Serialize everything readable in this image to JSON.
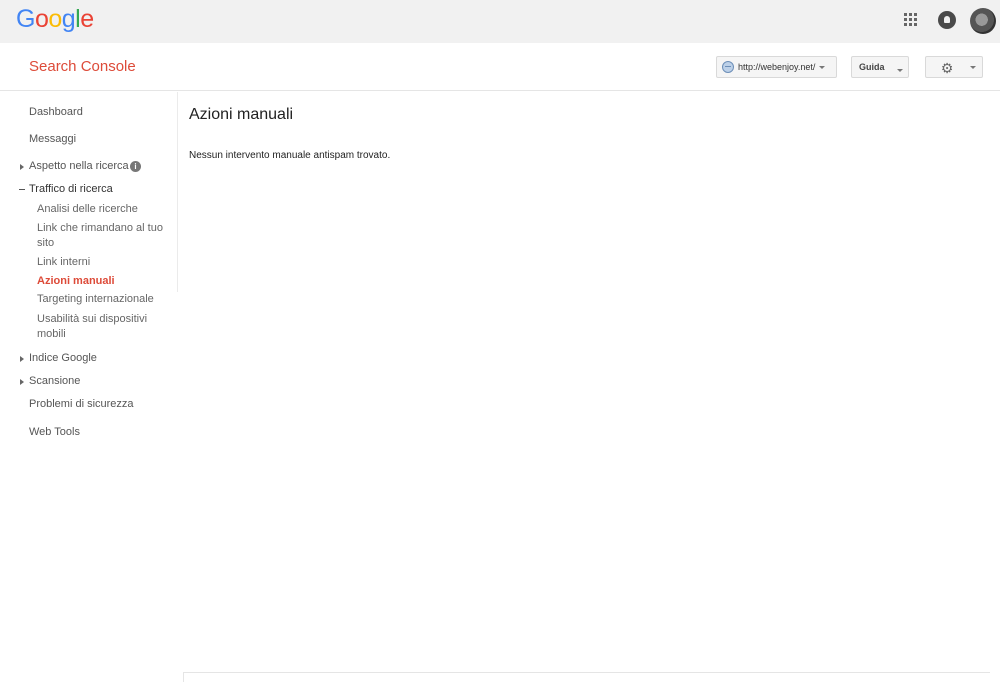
{
  "google_bar": {
    "logo": [
      "G",
      "o",
      "o",
      "g",
      "l",
      "e"
    ],
    "logo_colors": [
      "#4285f4",
      "#ea4335",
      "#fbbc05",
      "#4285f4",
      "#34a853",
      "#ea4335"
    ],
    "icons": [
      "apps-icon",
      "notifications-icon",
      "avatar"
    ]
  },
  "header": {
    "title": "Search Console",
    "title_color": "#dd4b39",
    "site_selector": "http://webenjoy.net/",
    "help_label": "Guida",
    "settings_icon": "gear-icon"
  },
  "sidebar": {
    "dashboard": "Dashboard",
    "messages": "Messaggi",
    "search_appearance": "Aspetto nella ricerca",
    "search_traffic": "Traffico di ricerca",
    "search_traffic_items": [
      "Analisi delle ricerche",
      "Link che rimandano al tuo sito",
      "Link interni",
      "Azioni manuali",
      "Targeting internazionale",
      "Usabilità sui dispositivi mobili"
    ],
    "active_item": "Azioni manuali",
    "google_index": "Indice Google",
    "crawl": "Scansione",
    "security_issues": "Problemi di sicurezza",
    "web_tools": "Web Tools"
  },
  "main": {
    "title": "Azioni manuali",
    "message": "Nessun intervento manuale antispam trovato."
  }
}
